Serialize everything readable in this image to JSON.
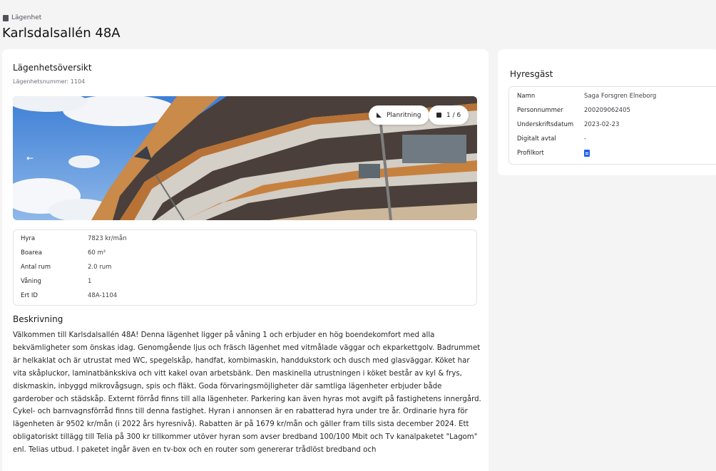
{
  "breadcrumb": {
    "label": "Lägenhet",
    "icon": "building-icon"
  },
  "page_title": "Karlsdalsallén 48A",
  "overview": {
    "title": "Lägenhetsöversikt",
    "apartment_number": "Lägenhetsnummer: 1104",
    "gallery": {
      "floorplan_label": "Planritning",
      "floorplan_icon": "floorplan-icon",
      "counter": "1 / 6",
      "counter_icon": "image-icon",
      "prev_icon": "arrow-left-icon"
    },
    "details": [
      {
        "label": "Hyra",
        "value": "7823 kr/mån"
      },
      {
        "label": "Boarea",
        "value": "60 m²"
      },
      {
        "label": "Antal rum",
        "value": "2.0 rum"
      },
      {
        "label": "Våning",
        "value": "1"
      },
      {
        "label": "Ert ID",
        "value": "48A-1104"
      }
    ],
    "description_title": "Beskrivning",
    "description": "Välkommen till Karlsdalsallén 48A! Denna lägenhet ligger på våning 1 och erbjuder en hög boendekomfort med alla bekvämligheter som önskas idag. Genomgående ljus och fräsch lägenhet med vitmålade väggar och ekparkettgolv. Badrummet är helkaklat och är utrustat med WC, spegelskåp, handfat, kombimaskin, handdukstork och dusch med glasväggar. Köket har vita skåpluckor, laminatbänkskiva och vitt kakel ovan arbetsbänk. Den maskinella utrustningen i köket består av kyl & frys, diskmaskin, inbyggd mikrovågsugn, spis och fläkt. Goda förvaringsmöjligheter där samtliga lägenheter erbjuder både garderober och städskåp. Externt förråd finns till alla lägenheter. Parkering kan även hyras mot avgift på fastighetens innergård. Cykel- och barnvagnsförråd finns till denna fastighet. Hyran i annonsen är en rabatterad hyra under tre år. Ordinarie hyra för lägenheten är 9502 kr/mån (i 2022 års hyresnivå). Rabatten är på 1679 kr/mån och gäller fram tills sista december 2024. Ett obligatoriskt tillägg till Telia på 300 kr tillkommer utöver hyran som avser bredband 100/100 Mbit och Tv kanalpaketet \"Lagom\" enl. Telias utbud. I paketet ingår även en tv-box och en router som genererar trådlöst bredband och"
  },
  "tenant": {
    "title": "Hyresgäst",
    "rows": [
      {
        "label": "Namn",
        "value": "Saga Forsgren Elneborg"
      },
      {
        "label": "Personnummer",
        "value": "200209062405"
      },
      {
        "label": "Underskriftsdatum",
        "value": "2023-02-23"
      },
      {
        "label": "Digitalt avtal",
        "value": "-"
      },
      {
        "label": "Profilkort",
        "value_icon": "document-icon"
      }
    ]
  }
}
